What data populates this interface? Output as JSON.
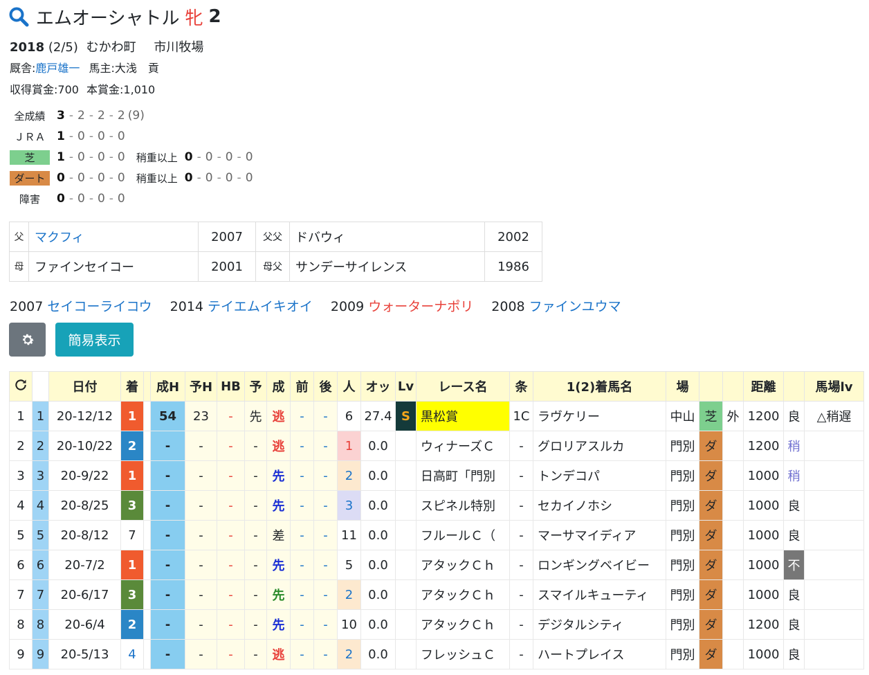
{
  "horse": {
    "name": "エムオーシャトル",
    "sex": "牝",
    "age": "2",
    "birth_year": "2018",
    "birth_date": "(2/5)",
    "region": "むかわ町",
    "breeder": "市川牧場",
    "stable_label": "厩舎:",
    "trainer": "鹿戸雄一",
    "owner_label": "馬主:",
    "owner": "大浅　貢",
    "earnings": "収得賞金:700",
    "prize": "本賞金:1,010"
  },
  "record": [
    {
      "label": "全成績",
      "w": "3",
      "s": "2",
      "t": "2",
      "o": "2",
      "total": "(9)"
    },
    {
      "label": "ＪＲＡ",
      "w": "1",
      "s": "0",
      "t": "0",
      "o": "0"
    },
    {
      "label": "芝",
      "w": "1",
      "s": "0",
      "t": "0",
      "o": "0",
      "sub_label": "稍重以上",
      "sw": "0",
      "ss": "0",
      "st": "0",
      "so": "0"
    },
    {
      "label": "ダート",
      "w": "0",
      "s": "0",
      "t": "0",
      "o": "0",
      "sub_label": "稍重以上",
      "sw": "0",
      "ss": "0",
      "st": "0",
      "so": "0"
    },
    {
      "label": "障害",
      "w": "0",
      "s": "0",
      "t": "0",
      "o": "0"
    }
  ],
  "pedigree": {
    "sire_label": "父",
    "sire": "マクフィ",
    "sire_year": "2007",
    "sire_sire_label": "父父",
    "sire_sire": "ドバウィ",
    "sire_sire_year": "2002",
    "dam_label": "母",
    "dam": "ファインセイコー",
    "dam_year": "2001",
    "dam_sire_label": "母父",
    "dam_sire": "サンデーサイレンス",
    "dam_sire_year": "1986"
  },
  "siblings": [
    {
      "year": "2007",
      "name": "セイコーライコウ",
      "color": "blue"
    },
    {
      "year": "2014",
      "name": "テイエムイキオイ",
      "color": "blue"
    },
    {
      "year": "2009",
      "name": "ウォーターナポリ",
      "color": "red"
    },
    {
      "year": "2008",
      "name": "ファインユウマ",
      "color": "blue"
    }
  ],
  "buttons": {
    "simple": "簡易表示"
  },
  "columns": [
    "日付",
    "着",
    "成H",
    "予H",
    "HB",
    "予",
    "成",
    "前",
    "後",
    "人",
    "オッ",
    "Lv",
    "レース名",
    "条",
    "1(2)着馬名",
    "場",
    "",
    "",
    "距離",
    "",
    "馬場lv"
  ],
  "races": [
    {
      "i": "1",
      "n": "1",
      "date": "20-12/12",
      "fin": "1",
      "h": "54",
      "yh": "23",
      "hb": "-",
      "yo": "先",
      "sei": "逃",
      "mae": "-",
      "ato": "-",
      "pop": "6",
      "odds": "27.4",
      "lv": "S",
      "race": "黒松賞",
      "jo": "1C",
      "winner": "ラヴケリー",
      "track": "中山",
      "surface": "芝",
      "course": "外",
      "dist": "1200",
      "cond": "良",
      "baba": "△稍遅"
    },
    {
      "i": "2",
      "n": "2",
      "date": "20-10/22",
      "fin": "2",
      "h": "-",
      "yh": "-",
      "hb": "-",
      "yo": "-",
      "sei": "逃",
      "mae": "-",
      "ato": "-",
      "pop": "1",
      "odds": "0.0",
      "lv": "",
      "race": "ウィナーズＣ",
      "jo": "-",
      "winner": "グロリアスルカ",
      "track": "門別",
      "surface": "ダ",
      "course": "",
      "dist": "1200",
      "cond": "稍",
      "baba": ""
    },
    {
      "i": "3",
      "n": "3",
      "date": "20-9/22",
      "fin": "1",
      "h": "-",
      "yh": "-",
      "hb": "-",
      "yo": "-",
      "sei": "先",
      "mae": "-",
      "ato": "-",
      "pop": "2",
      "odds": "0.0",
      "lv": "",
      "race": "日高町「門別",
      "jo": "-",
      "winner": "トンデコパ",
      "track": "門別",
      "surface": "ダ",
      "course": "",
      "dist": "1000",
      "cond": "稍",
      "baba": ""
    },
    {
      "i": "4",
      "n": "4",
      "date": "20-8/25",
      "fin": "3",
      "h": "-",
      "yh": "-",
      "hb": "-",
      "yo": "-",
      "sei": "先",
      "mae": "-",
      "ato": "-",
      "pop": "3",
      "odds": "0.0",
      "lv": "",
      "race": "スピネル特別",
      "jo": "-",
      "winner": "セカイノホシ",
      "track": "門別",
      "surface": "ダ",
      "course": "",
      "dist": "1000",
      "cond": "良",
      "baba": ""
    },
    {
      "i": "5",
      "n": "5",
      "date": "20-8/12",
      "fin": "7",
      "h": "-",
      "yh": "-",
      "hb": "-",
      "yo": "-",
      "sei": "差",
      "mae": "-",
      "ato": "-",
      "pop": "11",
      "odds": "0.0",
      "lv": "",
      "race": "フルールＣ（",
      "jo": "-",
      "winner": "マーサマイディア",
      "track": "門別",
      "surface": "ダ",
      "course": "",
      "dist": "1000",
      "cond": "良",
      "baba": ""
    },
    {
      "i": "6",
      "n": "6",
      "date": "20-7/2",
      "fin": "1",
      "h": "-",
      "yh": "-",
      "hb": "-",
      "yo": "-",
      "sei": "先",
      "mae": "-",
      "ato": "-",
      "pop": "5",
      "odds": "0.0",
      "lv": "",
      "race": "アタックＣｈ",
      "jo": "-",
      "winner": "ロンギングベイビー",
      "track": "門別",
      "surface": "ダ",
      "course": "",
      "dist": "1000",
      "cond": "不",
      "baba": ""
    },
    {
      "i": "7",
      "n": "7",
      "date": "20-6/17",
      "fin": "3",
      "h": "-",
      "yh": "-",
      "hb": "-",
      "yo": "-",
      "sei": "先",
      "mae": "-",
      "ato": "-",
      "pop": "2",
      "odds": "0.0",
      "lv": "",
      "race": "アタックＣｈ",
      "jo": "-",
      "winner": "スマイルキューティ",
      "track": "門別",
      "surface": "ダ",
      "course": "",
      "dist": "1000",
      "cond": "良",
      "baba": ""
    },
    {
      "i": "8",
      "n": "8",
      "date": "20-6/4",
      "fin": "2",
      "h": "-",
      "yh": "-",
      "hb": "-",
      "yo": "-",
      "sei": "先",
      "mae": "-",
      "ato": "-",
      "pop": "10",
      "odds": "0.0",
      "lv": "",
      "race": "アタックＣｈ",
      "jo": "-",
      "winner": "デジタルシティ",
      "track": "門別",
      "surface": "ダ",
      "course": "",
      "dist": "1200",
      "cond": "良",
      "baba": ""
    },
    {
      "i": "9",
      "n": "9",
      "date": "20-5/13",
      "fin": "4",
      "h": "-",
      "yh": "-",
      "hb": "-",
      "yo": "-",
      "sei": "逃",
      "mae": "-",
      "ato": "-",
      "pop": "2",
      "odds": "0.0",
      "lv": "",
      "race": "フレッシュＣ",
      "jo": "-",
      "winner": "ハートプレイス",
      "track": "門別",
      "surface": "ダ",
      "course": "",
      "dist": "1000",
      "cond": "良",
      "baba": ""
    }
  ],
  "colors": {
    "accent": "#1a73c9",
    "red": "#e8413a",
    "turf": "#7dcf8e",
    "dirt": "#d88a46",
    "header": "#fffbd0"
  },
  "icons": {
    "search": "search-icon",
    "gear": "gear-icon",
    "refresh": "refresh-icon"
  }
}
